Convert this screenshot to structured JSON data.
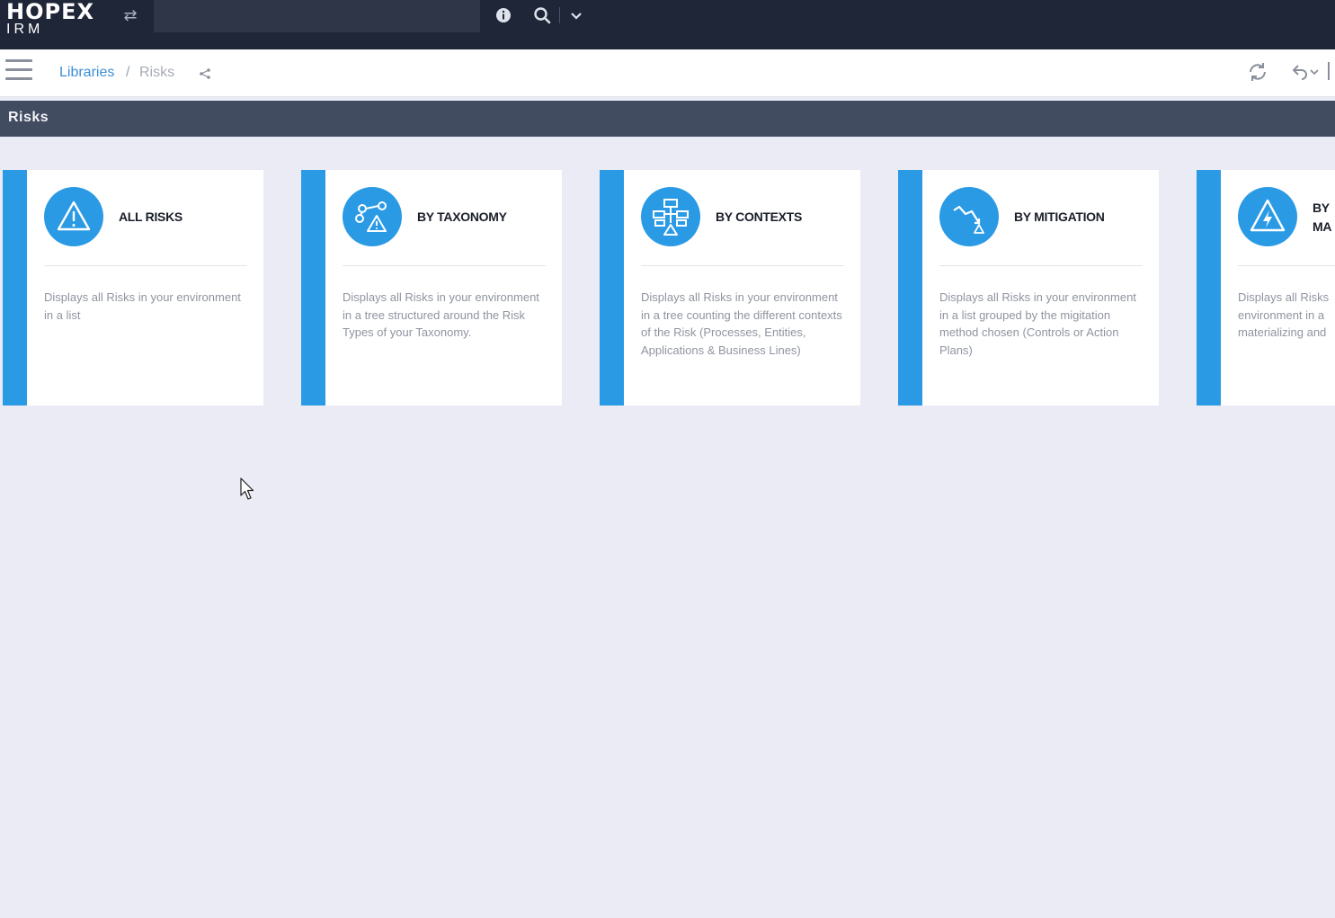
{
  "app": {
    "logo_main": "HOPEX",
    "logo_sub": "IRM"
  },
  "topbar": {
    "search_value": ""
  },
  "breadcrumb": {
    "items": [
      "Libraries",
      "Risks"
    ],
    "separator": "/"
  },
  "page": {
    "title": "Risks"
  },
  "cards": [
    {
      "title": "ALL RISKS",
      "description": "Displays all Risks in your environment in a list",
      "icon": "warning-triangle-icon"
    },
    {
      "title": "BY TAXONOMY",
      "description": "Displays all Risks in your environment in a tree structured around the Risk Types of your Taxonomy.",
      "icon": "taxonomy-tree-icon"
    },
    {
      "title": "BY CONTEXTS",
      "description": "Displays all Risks in your environment in a tree counting the different contexts of the Risk (Processes, Entities, Applications & Business Lines)",
      "icon": "contexts-network-icon"
    },
    {
      "title": "BY MITIGATION",
      "description": "Displays all Risks in your environment in a list grouped by the migitation method chosen (Controls or Action Plans)",
      "icon": "mitigation-chart-icon"
    },
    {
      "title": "BY MA",
      "description": "Displays all Risks environment in a materializing and",
      "icon": "lightning-triangle-icon"
    }
  ],
  "colors": {
    "accent": "#2b9ae5",
    "topbar_bg": "#1f2638",
    "title_bar_bg": "#424c61",
    "page_bg": "#ebebf5"
  }
}
